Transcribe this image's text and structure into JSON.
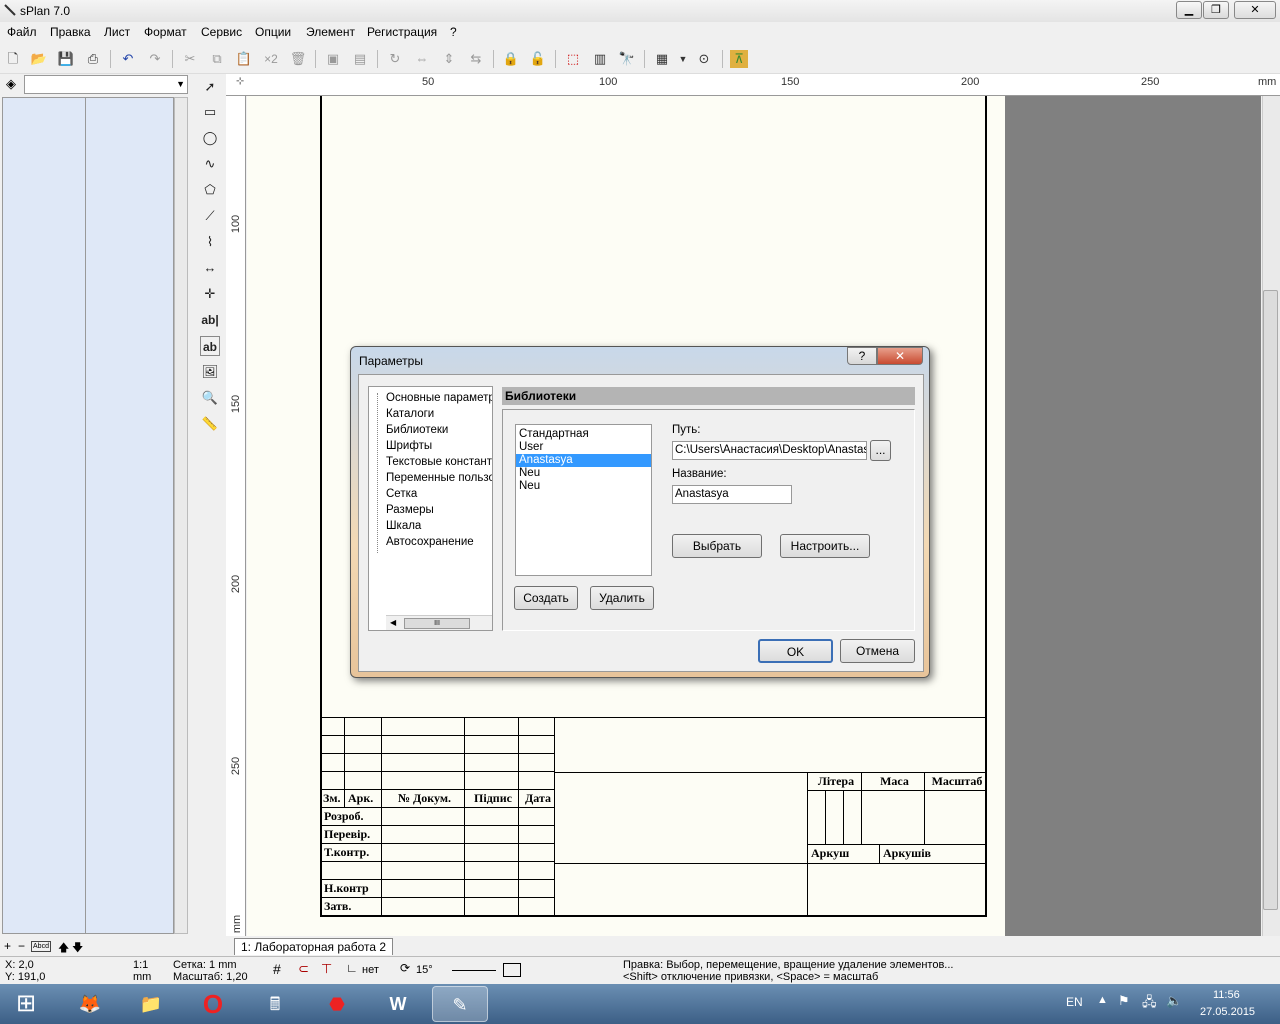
{
  "window": {
    "title": "sPlan 7.0"
  },
  "menu": [
    "Файл",
    "Правка",
    "Лист",
    "Формат",
    "Сервис",
    "Опции",
    "Элемент",
    "Регистрация",
    "?"
  ],
  "toolbar": {
    "zoom_badge": "×2"
  },
  "tools": {
    "text1": "ab|",
    "text2": "ab"
  },
  "ruler": {
    "unit": "mm",
    "h_labels": [
      "50",
      "100",
      "150",
      "200",
      "250"
    ],
    "v_labels": [
      "100",
      "150",
      "200",
      "250"
    ]
  },
  "stamp": {
    "zm": "Зм.",
    "ark": "Арк.",
    "doc": "№ Докум.",
    "pidpys": "Підпис",
    "data": "Дата",
    "rozrob": "Розроб.",
    "perevir": "Перевір.",
    "tkontr": "Т.контр.",
    "nkontr": "Н.контр",
    "zatv": "Затв.",
    "litera": "Літера",
    "masa": "Маса",
    "masshtab": "Масштаб",
    "arkush": "Аркуш",
    "arkushiv": "Аркушів"
  },
  "tab": {
    "label": "1: Лабораторная работа 2"
  },
  "status": {
    "x": "X: 2,0",
    "y": "Y: 191,0",
    "ratio": "1:1",
    "ratio_unit": "mm",
    "grid": "Сетка: 1 mm",
    "scale": "Масштаб:  1,20",
    "snap": "нет",
    "angle": "15°",
    "hint1": "Правка: Выбор, перемещение, вращение удаление элементов...",
    "hint2": "<Shift> отключение привязки, <Space> = масштаб"
  },
  "taskbar": {
    "lang": "EN",
    "time": "11:56",
    "date": "27.05.2015"
  },
  "dialog": {
    "title": "Параметры",
    "help": "?",
    "tree": [
      "Основные параметры",
      "Каталоги",
      "Библиотеки",
      "Шрифты",
      "Текстовые констант",
      "Переменные пользо",
      "Сетка",
      "Размеры",
      "Шкала",
      "Автосохранение"
    ],
    "tree_scroll": "III",
    "section": "Библиотеки",
    "libs": [
      "Стандартная",
      "User",
      "Anastasya",
      "Neu",
      "Neu"
    ],
    "path_label": "Путь:",
    "path_value": "C:\\Users\\Анастасия\\Desktop\\Anastas",
    "browse": "...",
    "name_label": "Название:",
    "name_value": "Anastasya",
    "choose": "Выбрать",
    "configure": "Настроить...",
    "create": "Создать",
    "delete": "Удалить",
    "ok": "OK",
    "cancel": "Отмена"
  }
}
